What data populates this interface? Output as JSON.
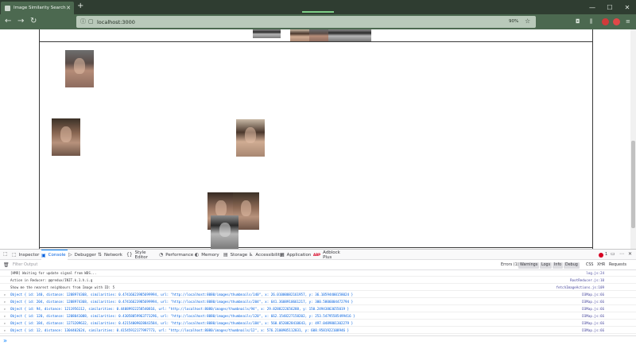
{
  "browser": {
    "tab_title": "Image Similarity Search Project",
    "new_tab": "+",
    "url": "localhost:3000",
    "zoom": "90%",
    "window_controls": [
      "minimize-icon",
      "maximize-icon",
      "close-icon"
    ]
  },
  "devtools": {
    "tabs": [
      {
        "icon": "⬚",
        "label": "Inspector"
      },
      {
        "icon": "▣",
        "label": "Console"
      },
      {
        "icon": "▷",
        "label": "Debugger"
      },
      {
        "icon": "⇅",
        "label": "Network"
      },
      {
        "icon": "{}",
        "label": "Style Editor"
      },
      {
        "icon": "◔",
        "label": "Performance"
      },
      {
        "icon": "◐",
        "label": "Memory"
      },
      {
        "icon": "▤",
        "label": "Storage"
      },
      {
        "icon": "♿",
        "label": "Accessibility"
      },
      {
        "icon": "▦",
        "label": "Application"
      },
      {
        "icon": "ABP",
        "label": "Adblock Plus"
      }
    ],
    "error_count": "1",
    "filter_placeholder": "Filter Output",
    "filters": [
      "Errors (1)",
      "Warnings",
      "Logs",
      "Info",
      "Debug",
      "CSS",
      "XHR",
      "Requests"
    ],
    "prompt": "»",
    "console_rows": [
      {
        "msg": "[HMR] Waiting for update signal from WDS...",
        "src": "log.js:24",
        "obj": false
      },
      {
        "msg": "Action in Reducer: @@redux/INIT.k.1.h.i.g",
        "src": "RootReducer.js:10",
        "obj": false
      },
      {
        "msg": "Show me the nearest neighbours from Image with ID: 5",
        "src": "fetchImageActions.js:109",
        "obj": false
      },
      {
        "msg": "Object { id: 140, distance: 1208974368, similarities: 0.47416623985699994, url: \"http://localhost:8080/images/thumbnails/140\", x: 26.01000082161957, y: 36.10594400158024 }",
        "src": "D3Map.js:66",
        "obj": true
      },
      {
        "msg": "Object { id: 204, distance: 1208974368, similarities: 0.47416623985699994, url: \"http://localhost:8080/images/thumbnails/204\", x: 641.3608910661217, y: 300.5806004472794 }",
        "src": "D3Map.js:66",
        "obj": true
      },
      {
        "msg": "Object { id: 94, distance: 1211956112, similarities: 0.44089922258540816, url: \"http://localhost:8080/images/thumbnails/94\", x: 29.8288222656288, y: 150.24943863655019 }",
        "src": "D3Map.js:66",
        "obj": true
      },
      {
        "msg": "Object { id: 120, distance: 1208041088, similarities: 0.43058059963773296, url: \"http://localhost:8080/images/thumbnails/120\", x: 662.1548227158202, y: 253.54795585499416 }",
        "src": "D3Map.js:66",
        "obj": true
      },
      {
        "msg": "Object { id: 184, distance: 1273209632, similarities: 0.42154009028843584, url: \"http://localhost:8080/images/thumbnails/184\", x: 560.0520828410643, y: 497.0489801302279 }",
        "src": "D3Map.js:66",
        "obj": true
      },
      {
        "msg": "Object { id: 12, distance: 1304402624, similarities: 0.41545912177997773, url: \"http://localhost:8080/images/thumbnails/12\", x: 576.2100905112831, y: 608.9581922108946 }",
        "src": "D3Map.js:66",
        "obj": true
      }
    ]
  }
}
